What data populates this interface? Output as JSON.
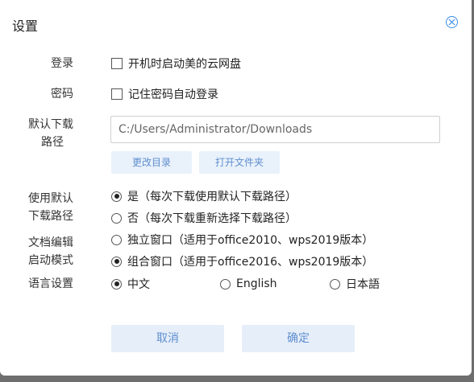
{
  "dialog": {
    "title": "设置"
  },
  "login": {
    "label": "登录",
    "option": "开机时启动美的云网盘"
  },
  "password": {
    "label": "密码",
    "option": "记住密码自动登录"
  },
  "download": {
    "label_line1": "默认下载",
    "label_line2": "路径",
    "path_value": "C:/Users/Administrator/Downloads",
    "change_dir_label": "更改目录",
    "open_folder_label": "打开文件夹"
  },
  "use_default": {
    "label_line1": "使用默认",
    "label_line2": "下载路径",
    "options": [
      {
        "label": "是（每次下载使用默认下载路径）",
        "selected": true
      },
      {
        "label": "否（每次下载重新选择下载路径）",
        "selected": false
      }
    ]
  },
  "doc_edit": {
    "label_line1": "文档编辑",
    "label_line2": "启动模式",
    "options": [
      {
        "label": "独立窗口（适用于office2010、wps2019版本）",
        "selected": false
      },
      {
        "label": "组合窗口（适用于office2016、wps2019版本）",
        "selected": true
      }
    ]
  },
  "language": {
    "label": "语言设置",
    "options": [
      {
        "label": "中文",
        "selected": true
      },
      {
        "label": "English",
        "selected": false
      },
      {
        "label": "日本語",
        "selected": false
      }
    ]
  },
  "footer": {
    "cancel_label": "取消",
    "confirm_label": "确定"
  },
  "colors": {
    "accent": "#3a8ee6",
    "button_bg": "#e6eef9",
    "button_text": "#5f8fcf"
  }
}
